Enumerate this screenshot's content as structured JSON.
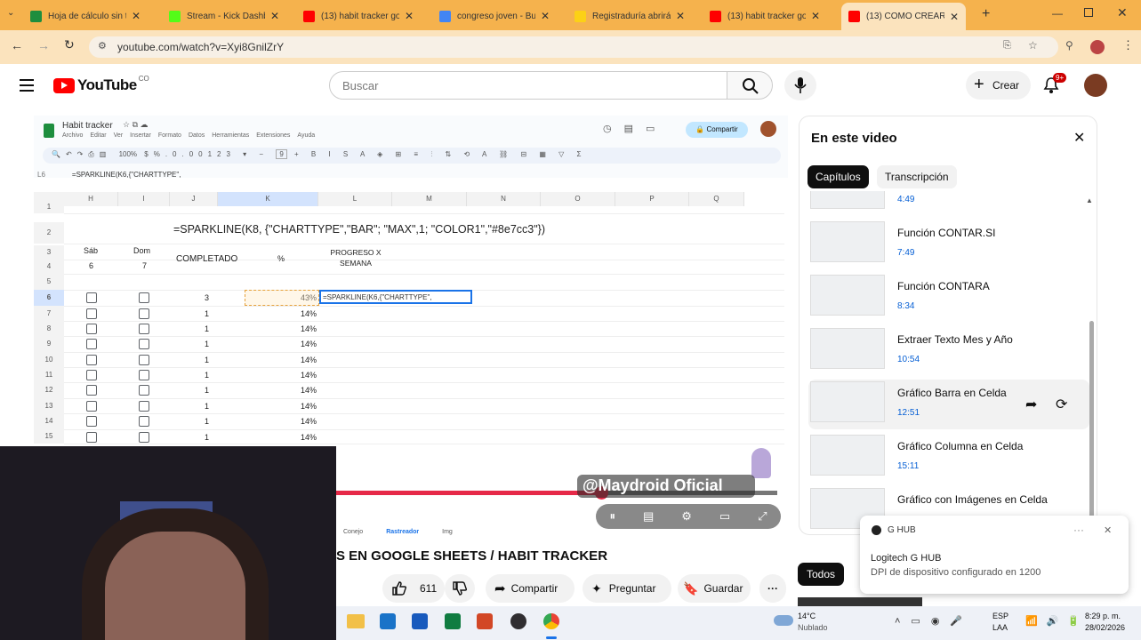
{
  "browser": {
    "tabs": [
      {
        "title": "Hoja de cálculo sin t",
        "color": "#1e8e3e"
      },
      {
        "title": "Stream - Kick Dashb",
        "color": "#53fc18"
      },
      {
        "title": "(13) habit tracker go",
        "color": "#ff0000"
      },
      {
        "title": "congreso joven - Bu",
        "color": "#4285f4"
      },
      {
        "title": "Registraduría abrirá",
        "color": "#fcd116"
      },
      {
        "title": "(13) habit tracker go",
        "color": "#ff0000"
      },
      {
        "title": "(13) COMO CREAR U",
        "color": "#ff0000"
      }
    ],
    "new_tab": "+",
    "url": "youtube.com/watch?v=Xyi8GnilZrY"
  },
  "youtube": {
    "logo": "YouTube",
    "country": "CO",
    "search_placeholder": "Buscar",
    "create_label": "Crear",
    "notif_count": "9+"
  },
  "sheet": {
    "title": "Habit tracker",
    "menu": [
      "Archivo",
      "Editar",
      "Ver",
      "Insertar",
      "Formato",
      "Datos",
      "Herramientas",
      "Extensiones",
      "Ayuda"
    ],
    "share": "Compartir",
    "zoom": "100%",
    "font_size": "9",
    "cell_ref": "L6",
    "formula_bar": "=SPARKLINE(K6,{\"CHARTTYPE\",",
    "columns": [
      "H",
      "I",
      "J",
      "K",
      "L",
      "M",
      "N",
      "O",
      "P",
      "Q"
    ],
    "rows": [
      "1",
      "2",
      "3",
      "4",
      "5",
      "6",
      "7",
      "8",
      "9",
      "10",
      "11",
      "12",
      "13",
      "14",
      "15"
    ],
    "big_formula": "=SPARKLINE(K8, {\"CHARTTYPE\",\"BAR\"; \"MAX\",1; \"COLOR1\",\"#8e7cc3\"})",
    "hdr_sab": "Sáb",
    "hdr_sab_num": "6",
    "hdr_dom": "Dom",
    "hdr_dom_num": "7",
    "hdr_completado": "COMPLETADO",
    "hdr_pct": "%",
    "hdr_progreso": "PROGRESO X SEMANA",
    "completado": [
      "3",
      "1",
      "1",
      "1",
      "1",
      "1",
      "1",
      "1",
      "1",
      "1"
    ],
    "pct": [
      "43%",
      "14%",
      "14%",
      "14%",
      "14%",
      "14%",
      "14%",
      "14%",
      "14%",
      "14%"
    ],
    "editing": "=SPARKLINE(K6,{\"CHARTTYPE\",",
    "sheet_tabs": [
      "Conejo",
      "Rastreador",
      "Img"
    ],
    "watermark": "@Maydroid Oficial"
  },
  "video": {
    "title_visible": "S EN GOOGLE SHEETS / HABIT TRACKER",
    "likes": "611",
    "share": "Compartir",
    "ask": "Preguntar",
    "save": "Guardar",
    "progress_fraction": 0.6
  },
  "panel": {
    "title": "En este video",
    "tab_chapters": "Capítulos",
    "tab_transcript": "Transcripción",
    "chapters": [
      {
        "name": "",
        "time": "4:49"
      },
      {
        "name": "Función CONTAR.SI",
        "time": "7:49"
      },
      {
        "name": "Función CONTARA",
        "time": "8:34"
      },
      {
        "name": "Extraer Texto Mes y Año",
        "time": "10:54"
      },
      {
        "name": "Gráfico Barra en Celda",
        "time": "12:51"
      },
      {
        "name": "Gráfico Columna en Celda",
        "time": "15:11"
      },
      {
        "name": "Gráfico con Imágenes en Celda",
        "time": ""
      }
    ],
    "filter_all": "Todos"
  },
  "toast": {
    "app": "G HUB",
    "title": "Logitech G HUB",
    "message": "DPI de dispositivo configurado en 1200",
    "more": "···"
  },
  "taskbar": {
    "temp": "14°C",
    "weather": "Nublado",
    "lang1": "ESP",
    "lang2": "LAA",
    "time": "8:29 p. m.",
    "date": "28/02/2026"
  }
}
